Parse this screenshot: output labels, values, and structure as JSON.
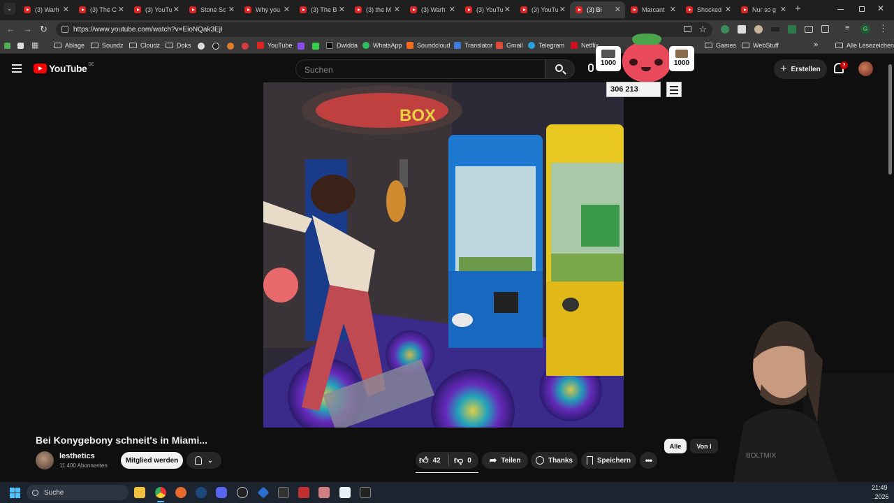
{
  "browser": {
    "tabs": [
      {
        "label": "(3) Warh"
      },
      {
        "label": "(3) The C"
      },
      {
        "label": "(3) YouTu"
      },
      {
        "label": "Stone Sc"
      },
      {
        "label": "Why you"
      },
      {
        "label": "(3) The B"
      },
      {
        "label": "(3) the M"
      },
      {
        "label": "(3) Warh"
      },
      {
        "label": "(3) YouTu"
      },
      {
        "label": "(3) YouTu"
      },
      {
        "label": "(3) Bi"
      },
      {
        "label": "Marcant"
      },
      {
        "label": "Shocked"
      },
      {
        "label": "Nur so g"
      }
    ],
    "new_tab_symbol": "+",
    "url": "https://www.youtube.com/watch?v=EioNQak3EjI",
    "bookmarks": {
      "items": [
        "Ablage",
        "Soundz",
        "Cloudz",
        "Doks",
        "YouTube",
        "Dwidda",
        "WhatsApp",
        "Soundcloud",
        "Translator",
        "Gmail",
        "Telegram",
        "Netflix",
        "Games",
        "WebStuff"
      ],
      "all_bookmarks": "Alle Lesezeichen",
      "more": "»"
    }
  },
  "youtube": {
    "logo_text": "YouTube",
    "region": "DE",
    "search_placeholder": "Suchen",
    "create_label": "Erstellen",
    "notification_count": "3",
    "video": {
      "title": "Bei Konygebony schneit's in Miami..."
    },
    "channel": {
      "name": "lesthetics",
      "subscribers": "11.400 Abonnenten",
      "join_label": "Mitglied werden"
    },
    "actions": {
      "likes": "42",
      "dislikes": "0",
      "share": "Teilen",
      "thanks": "Thanks",
      "save": "Speichern"
    },
    "chips": [
      "Alle",
      "Von l"
    ]
  },
  "overlay": {
    "left_counter": "1000",
    "right_counter": "1000",
    "total": "306 213"
  },
  "taskbar": {
    "search_label": "Suche",
    "time": "21:49",
    "date": ".2026"
  }
}
